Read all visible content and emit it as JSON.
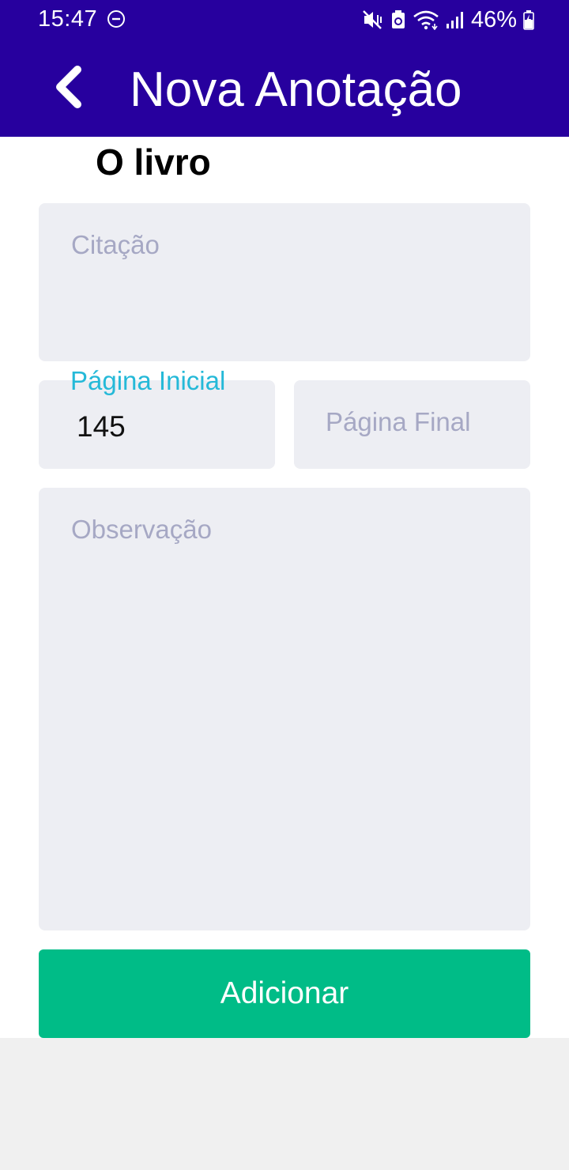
{
  "status_bar": {
    "time": "15:47",
    "battery_percent": "46%",
    "icons": [
      "dnd-icon",
      "mute-vibrate-icon",
      "battery-saver-icon",
      "wifi-icon",
      "signal-icon",
      "battery-charging-icon"
    ]
  },
  "header": {
    "title": "Nova Anotação",
    "back_icon": "chevron-left-icon",
    "background": "#27009e"
  },
  "book": {
    "title": "O livro"
  },
  "form": {
    "citacao_placeholder": "Citação",
    "pagina_inicial_label": "Página Inicial",
    "pagina_inicial_value": "145",
    "pagina_final_placeholder": "Página Final",
    "observacao_placeholder": "Observação"
  },
  "actions": {
    "add_label": "Adicionar",
    "add_color": "#00bc87"
  }
}
